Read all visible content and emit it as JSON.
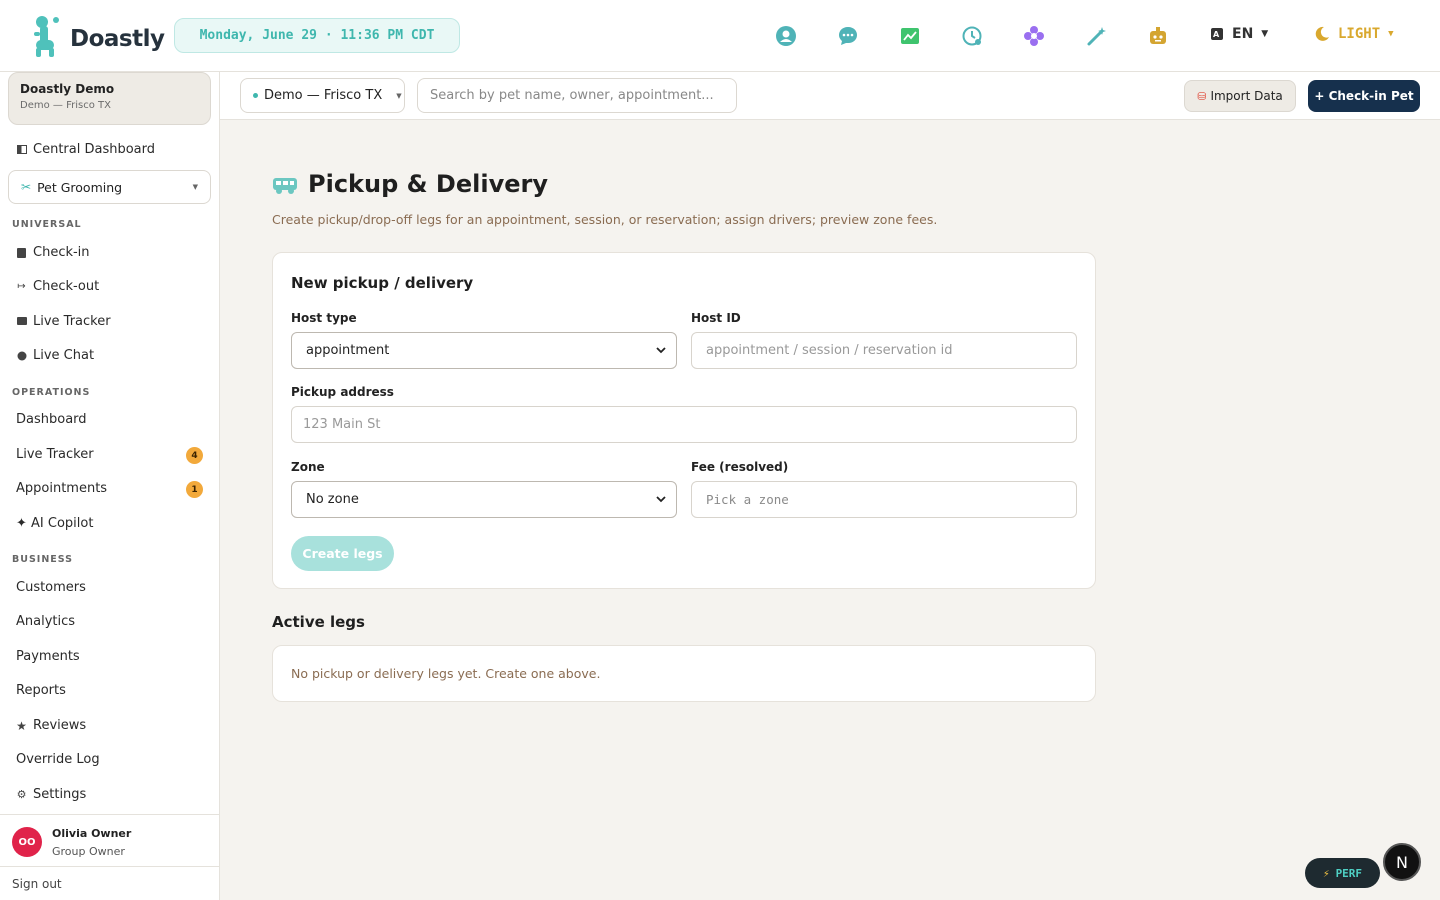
{
  "brand": {
    "name": "Doastly"
  },
  "header": {
    "datetime": "Monday, June 29 · 11:36 PM CDT",
    "icons": [
      "support-icon",
      "chat-icon",
      "chart-icon",
      "clock-icon",
      "flower-icon",
      "magic-wand-icon",
      "robot-icon"
    ],
    "language": "EN",
    "theme": "LIGHT"
  },
  "sidebar": {
    "org": {
      "name": "Doastly Demo",
      "location": "Demo — Frisco TX"
    },
    "central_dashboard": "Central Dashboard",
    "module": "Pet Grooming",
    "sections": {
      "universal": "UNIVERSAL",
      "operations": "OPERATIONS",
      "business": "BUSINESS"
    },
    "universal_items": [
      "Check-in",
      "Check-out",
      "Live Tracker",
      "Live Chat"
    ],
    "operations_items": [
      "Dashboard",
      "Live Tracker",
      "Appointments",
      "✦ AI Copilot"
    ],
    "operations_badges": {
      "live_tracker": "4",
      "appointments": "1"
    },
    "business_items": [
      "Customers",
      "Analytics",
      "Payments",
      "Reports",
      "Reviews",
      "Override Log",
      "Settings"
    ],
    "user": {
      "initials": "OO",
      "name": "Olivia Owner",
      "role": "Group Owner"
    },
    "signout": "Sign out"
  },
  "toolbar": {
    "location": "Demo — Frisco TX",
    "search_placeholder": "Search by pet name, owner, appointment...",
    "import_label": "Import Data",
    "checkin_label": "+ Check-in Pet"
  },
  "page": {
    "title": "Pickup & Delivery",
    "description": "Create pickup/drop-off legs for an appointment, session, or reservation; assign drivers; preview zone fees."
  },
  "form": {
    "title": "New pickup / delivery",
    "host_type_label": "Host type",
    "host_type_value": "appointment",
    "host_id_label": "Host ID",
    "host_id_placeholder": "appointment / session / reservation id",
    "pickup_label": "Pickup address",
    "pickup_placeholder": "123 Main St",
    "zone_label": "Zone",
    "zone_value": "No zone",
    "fee_label": "Fee (resolved)",
    "fee_placeholder": "Pick a zone",
    "create_label": "Create legs"
  },
  "active": {
    "title": "Active legs",
    "empty": "No pickup or delivery legs yet. Create one above."
  },
  "widgets": {
    "perf": "PERF",
    "n": "N"
  },
  "colors": {
    "accent": "#3fb7ae",
    "navy": "#16304d",
    "badge": "#f2a93b",
    "avatar": "#e0234a"
  }
}
